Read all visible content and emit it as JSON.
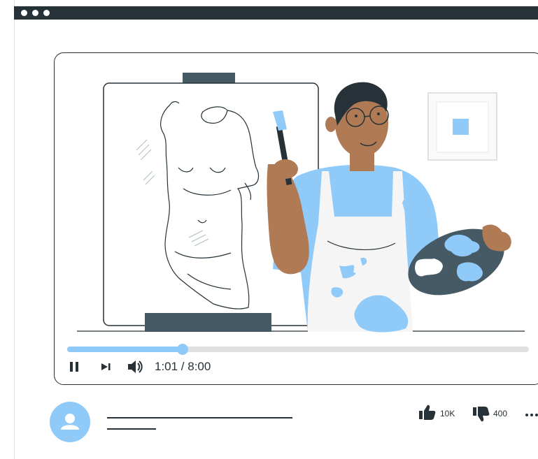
{
  "window": {
    "controls": [
      "close-dot",
      "minimize-dot",
      "maximize-dot"
    ]
  },
  "player": {
    "progress_fraction": 0.25,
    "time": "1:01 / 8:00",
    "accent_color": "#90caf9",
    "dark_color": "#263238",
    "icons": [
      "pause-icon",
      "next-icon",
      "volume-icon"
    ]
  },
  "actions": {
    "likes": "10K",
    "dislikes": "400",
    "icons": [
      "thumbs-up-icon",
      "thumbs-down-icon",
      "more-icon"
    ]
  },
  "channel": {
    "icon": "user-icon"
  }
}
